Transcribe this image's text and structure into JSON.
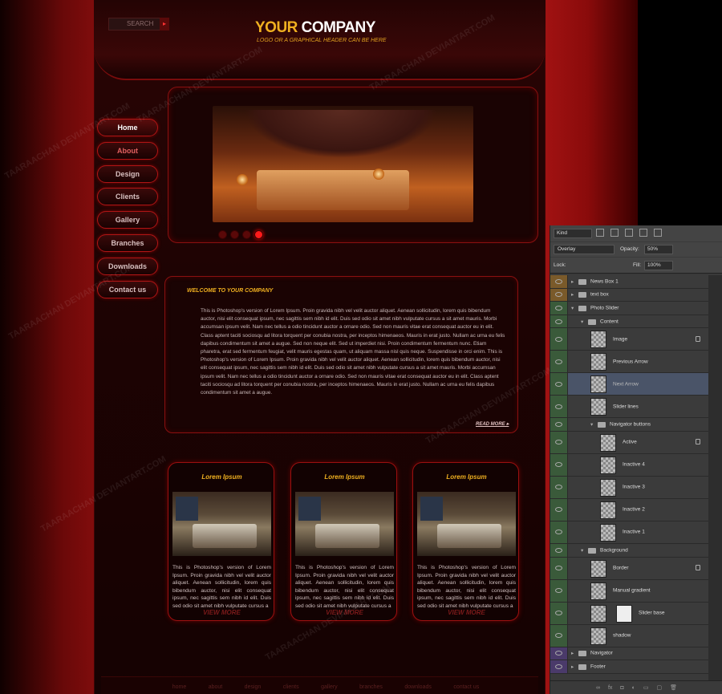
{
  "header": {
    "search_label": "SEARCH",
    "logo_your": "YOUR",
    "logo_company": " COMPANY",
    "tagline": "LOGO OR A GRAPHICAL HEADER CAN BE HERE"
  },
  "nav": {
    "items": [
      "Home",
      "About",
      "Design",
      "Clients",
      "Gallery",
      "Branches",
      "Downloads",
      "Contact us"
    ]
  },
  "slider": {
    "dots": 4,
    "active_dot": 4
  },
  "welcome": {
    "title": "WELCOME TO YOUR COMPANY",
    "body": "This is Photoshop's version of Lorem Ipsum. Proin gravida nibh vel velit auctor aliquet. Aenean sollicitudin, lorem quis bibendum auctor, nisi elit consequat ipsum, nec sagittis sem nibh id elit. Duis sed odio sit amet nibh vulputate cursus a sit amet mauris. Morbi accumsan ipsum velit. Nam nec tellus a odio tincidunt auctor a ornare odio. Sed non mauris vitae erat consequat auctor eu in elit. Class aptent taciti sociosqu ad litora torquent per conubia nostra, per inceptos himenaeos. Mauris in erat justo. Nullam ac urna eu felis dapibus condimentum sit amet a augue. Sed non neque elit. Sed ut imperdiet nisi. Proin condimentum fermentum nunc. Etiam pharetra, erat sed fermentum feugiat, velit mauris egestas quam, ut aliquam massa nisl quis neque. Suspendisse in orci enim. This is Photoshop's version of Lorem Ipsum. Proin gravida nibh vel velit auctor aliquet. Aenean sollicitudin, lorem quis bibendum auctor, nisi elit consequat ipsum, nec sagittis sem nibh id elit. Duis sed odio sit amet nibh vulputate cursus a sit amet mauris. Morbi accumsan ipsum velit. Nam nec tellus a odio tincidunt auctor a ornare odio. Sed non mauris vitae erat consequat auctor eu in elit. Class aptent taciti sociosqu ad litora torquent per conubia nostra, per inceptos himenaeos. Mauris in erat justo. Nullam ac urna eu felis dapibus condimentum sit amet a augue.",
    "read_more": "READ MORE ▸"
  },
  "boxes": [
    {
      "title": "Lorem Ipsum",
      "body": "This is Photoshop's version of Lorem Ipsum. Proin gravida nibh vel velit auctor aliquet. Aenean sollicitudin, lorem quis bibendum auctor, nisi elit consequat ipsum, nec sagittis sem nibh id elit. Duis sed odio sit amet nibh vulputate cursus a",
      "more": "VIEW MORE"
    },
    {
      "title": "Lorem Ipsum",
      "body": "This is Photoshop's version of Lorem Ipsum. Proin gravida nibh vel velit auctor aliquet. Aenean sollicitudin, lorem quis bibendum auctor, nisi elit consequat ipsum, nec sagittis sem nibh id elit. Duis sed odio sit amet nibh vulputate cursus a",
      "more": "VIEW MORE"
    },
    {
      "title": "Lorem Ipsum",
      "body": "This is Photoshop's version of Lorem Ipsum. Proin gravida nibh vel velit auctor aliquet. Aenean sollicitudin, lorem quis bibendum auctor, nisi elit consequat ipsum, nec sagittis sem nibh id elit. Duis sed odio sit amet nibh vulputate cursus a",
      "more": "VIEW MORE"
    }
  ],
  "footer": {
    "links": [
      "home",
      "about",
      "design",
      "clients",
      "gallery",
      "branches",
      "downloads",
      "contact us"
    ]
  },
  "layers_panel": {
    "kind_label": "Kind",
    "blend_mode": "Overlay",
    "opacity_label": "Opacity:",
    "opacity_value": "50%",
    "lock_label": "Lock:",
    "fill_label": "Fill:",
    "fill_value": "100%",
    "layers": [
      {
        "name": "News Box 1",
        "type": "folder",
        "indent": 1,
        "eye_color": "#7a5a2a"
      },
      {
        "name": "text box",
        "type": "folder",
        "indent": 1,
        "eye_color": "#7a5a2a"
      },
      {
        "name": "Photo Slider",
        "type": "folder-open",
        "indent": 1,
        "eye_color": "#3a5a3a"
      },
      {
        "name": "Content",
        "type": "folder-open",
        "indent": 2,
        "eye_color": "#3a5a3a"
      },
      {
        "name": "Image",
        "type": "layer",
        "indent": 3,
        "locked": true,
        "eye_color": "#3a5a3a"
      },
      {
        "name": "Previous Arrow",
        "type": "layer",
        "indent": 3,
        "eye_color": "#3a5a3a"
      },
      {
        "name": "Next Arrow",
        "type": "layer",
        "indent": 3,
        "selected": true,
        "eye_color": "#3a5a3a"
      },
      {
        "name": "Slider lines",
        "type": "layer",
        "indent": 3,
        "eye_color": "#3a5a3a"
      },
      {
        "name": "Navigator buttons",
        "type": "folder-open",
        "indent": 3,
        "eye_color": "#3a5a3a"
      },
      {
        "name": "Active",
        "type": "layer",
        "indent": 4,
        "locked": true,
        "eye_color": "#3a5a3a"
      },
      {
        "name": "Inactive 4",
        "type": "layer",
        "indent": 4,
        "eye_color": "#3a5a3a"
      },
      {
        "name": "Inactive 3",
        "type": "layer",
        "indent": 4,
        "eye_color": "#3a5a3a"
      },
      {
        "name": "Inactive 2",
        "type": "layer",
        "indent": 4,
        "eye_color": "#3a5a3a"
      },
      {
        "name": "Inactive 1",
        "type": "layer",
        "indent": 4,
        "eye_color": "#3a5a3a"
      },
      {
        "name": "Background",
        "type": "folder-open",
        "indent": 2,
        "eye_color": "#3a5a3a"
      },
      {
        "name": "Border",
        "type": "layer",
        "indent": 3,
        "locked": true,
        "eye_color": "#3a5a3a"
      },
      {
        "name": "Manual gradient",
        "type": "layer",
        "indent": 3,
        "eye_color": "#3a5a3a"
      },
      {
        "name": "Slider base",
        "type": "layer-mask",
        "indent": 3,
        "eye_color": "#3a5a3a"
      },
      {
        "name": "shadow",
        "type": "layer",
        "indent": 3,
        "eye_color": "#3a5a3a"
      },
      {
        "name": "Navigator",
        "type": "folder",
        "indent": 1,
        "eye_color": "#4a3a6a"
      },
      {
        "name": "Footer",
        "type": "folder",
        "indent": 1,
        "eye_color": "#4a3a6a"
      }
    ]
  },
  "watermark": "TAARAACHAN DEVIANTART.COM"
}
